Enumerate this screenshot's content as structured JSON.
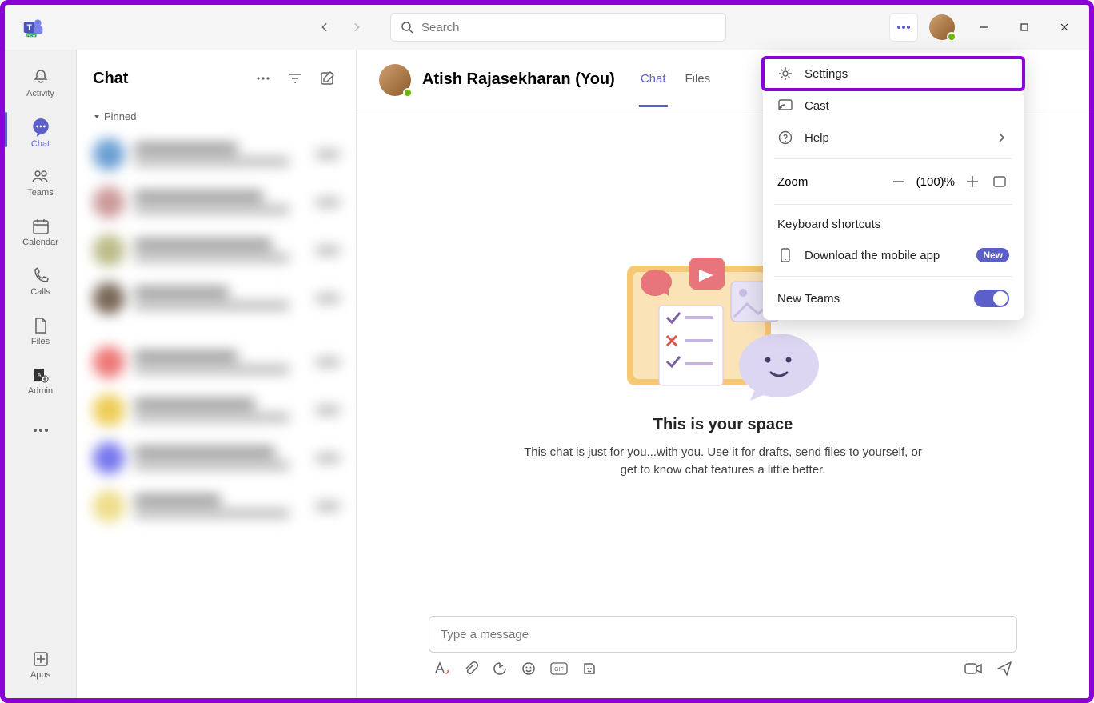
{
  "titlebar": {
    "search_placeholder": "Search"
  },
  "rail": {
    "items": [
      {
        "label": "Activity"
      },
      {
        "label": "Chat"
      },
      {
        "label": "Teams"
      },
      {
        "label": "Calendar"
      },
      {
        "label": "Calls"
      },
      {
        "label": "Files"
      },
      {
        "label": "Admin"
      }
    ],
    "apps_label": "Apps"
  },
  "chatlist": {
    "title": "Chat",
    "pinned_label": "Pinned"
  },
  "conversation": {
    "name": "Atish Rajasekharan (You)",
    "tabs": [
      {
        "label": "Chat"
      },
      {
        "label": "Files"
      }
    ],
    "empty_title": "This is your space",
    "empty_sub": "This chat is just for you...with you. Use it for drafts, send files to yourself, or get to know chat features a little better."
  },
  "compose": {
    "placeholder": "Type a message"
  },
  "menu": {
    "settings": "Settings",
    "cast": "Cast",
    "help": "Help",
    "zoom_label": "Zoom",
    "zoom_value": "(100)%",
    "keyboard": "Keyboard shortcuts",
    "download": "Download the mobile app",
    "download_badge": "New",
    "new_teams": "New Teams"
  }
}
